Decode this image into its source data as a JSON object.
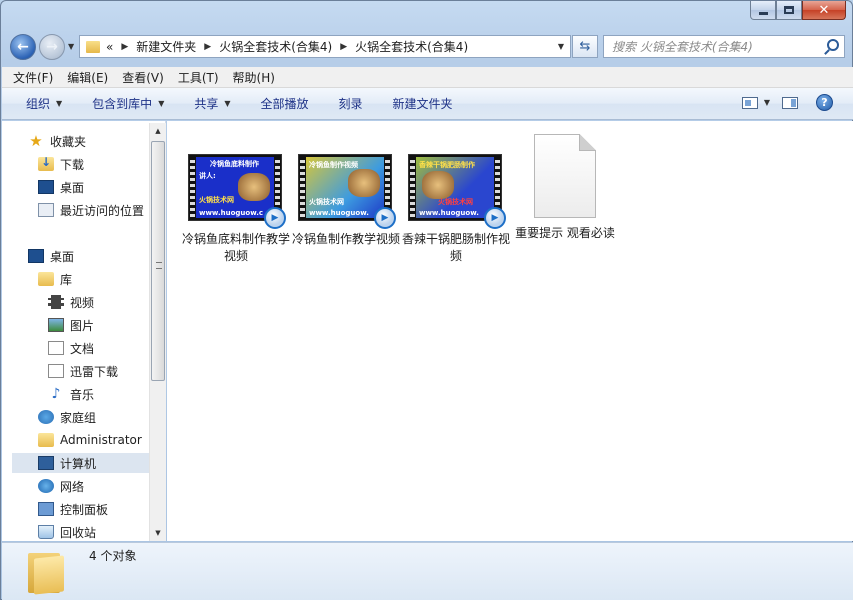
{
  "window": {
    "caption_buttons": {
      "minimize": "minimize",
      "maximize": "maximize",
      "close": "✕"
    }
  },
  "address": {
    "overflow": "«",
    "crumbs": [
      "新建文件夹",
      "火锅全套技术(合集4)",
      "火锅全套技术(合集4)"
    ],
    "search_placeholder": "搜索 火锅全套技术(合集4)"
  },
  "menu": [
    "文件(F)",
    "编辑(E)",
    "查看(V)",
    "工具(T)",
    "帮助(H)"
  ],
  "toolbar": {
    "organize": "组织",
    "include_library": "包含到库中",
    "share": "共享",
    "play_all": "全部播放",
    "burn": "刻录",
    "new_folder": "新建文件夹",
    "help": "?"
  },
  "nav": {
    "favorites": "收藏夹",
    "downloads": "下载",
    "desktop_fav": "桌面",
    "recent": "最近访问的位置",
    "desktop": "桌面",
    "libraries": "库",
    "videos": "视频",
    "pictures": "图片",
    "documents": "文档",
    "thunder": "迅雷下载",
    "music": "音乐",
    "homegroup": "家庭组",
    "admin": "Administrator",
    "computer": "计算机",
    "network": "网络",
    "control_panel": "控制面板",
    "recycle_bin": "回收站"
  },
  "files": [
    {
      "name": "冷锅鱼底料制作教学视频",
      "type": "video",
      "thumb_lines": [
        "冷锅鱼底料制作",
        "讲人:",
        "火锅技术网",
        "www.huoguow.c"
      ]
    },
    {
      "name": "冷锅鱼制作教学视频",
      "type": "video",
      "thumb_lines": [
        "冷锅鱼制作视频",
        "火锅技术网",
        "www.huoguow."
      ]
    },
    {
      "name": "香辣干锅肥肠制作视频",
      "type": "video",
      "thumb_lines": [
        "香辣干锅肥肠制作",
        "火锅技术网",
        "www.huoguow."
      ]
    },
    {
      "name": "重要提示 观看必读",
      "type": "text"
    }
  ],
  "status": {
    "count": "4 个对象"
  },
  "colors": {
    "accent": "#1e3287",
    "selection": "#dce5f0",
    "title_bg": "#b6cde8"
  }
}
